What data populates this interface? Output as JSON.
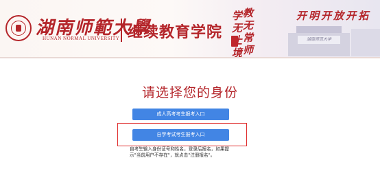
{
  "header": {
    "school_name": "湖南师範大學",
    "school_name_en": "HUNAN NORMAL UNIVERSITY",
    "college_name": "继续教育学院",
    "motto": [
      "学",
      "无",
      "止",
      "境",
      "教",
      "无",
      "常",
      "师"
    ],
    "slogan": "开明开放开拓",
    "building_plate": "湖南师范大学"
  },
  "main": {
    "title": "请选择您的身份",
    "gaokao_button": "成人高考考生报考入口",
    "zikao_button": "自学考试考生报考入口",
    "hint": "自考生输入身份证号和姓名，登录后报名，如果提示\"当前用户不存在\"，就点击\"注册报名\"。"
  },
  "colors": {
    "brand_red": "#b4252a",
    "button_blue": "#4285e4",
    "highlight_red": "#e03030"
  }
}
